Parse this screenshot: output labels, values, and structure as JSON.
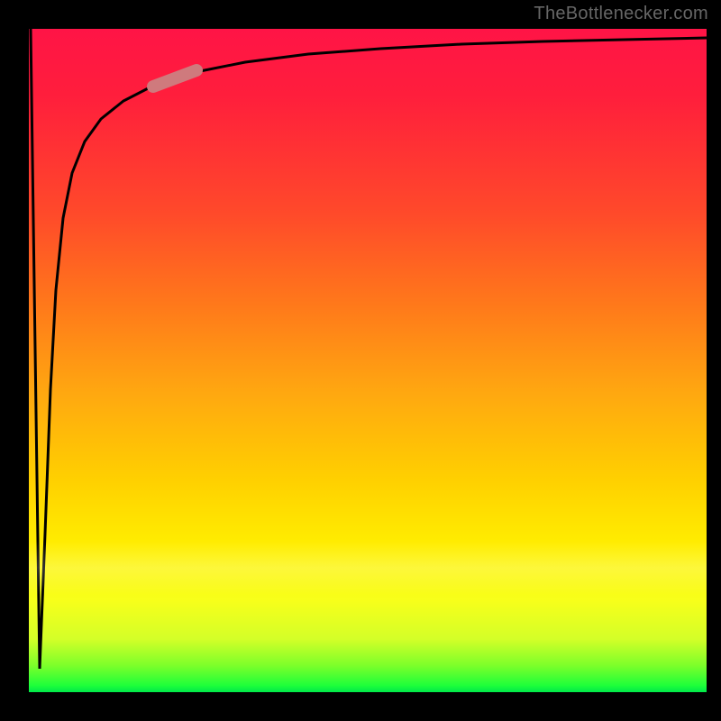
{
  "watermark": "TheBottlenecker.com",
  "chart_data": {
    "type": "line",
    "title": "",
    "xlabel": "",
    "ylabel": "",
    "xlim": [
      0,
      100
    ],
    "ylim": [
      0,
      100
    ],
    "x": [
      0,
      0.5,
      1,
      1.5,
      2,
      3,
      4,
      5,
      7,
      10,
      15,
      20,
      30,
      40,
      50,
      60,
      70,
      80,
      90,
      100
    ],
    "values": [
      100,
      50,
      10,
      40,
      65,
      78,
      83,
      86,
      89,
      91,
      93,
      94,
      95.5,
      96.2,
      96.8,
      97.2,
      97.5,
      97.8,
      98.0,
      98.2
    ],
    "marker_region": {
      "x_start": 17,
      "x_end": 24,
      "y_start": 88,
      "y_end": 92
    },
    "background_gradient": [
      "#ff1446",
      "#ffee00",
      "#00e84a"
    ],
    "notes": "Curve dips sharply near x≈0 then recovers logarithmically toward ~98. Values estimated from pixels; no axis ticks or labels present."
  }
}
